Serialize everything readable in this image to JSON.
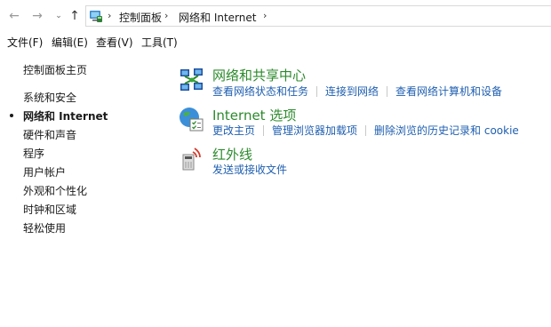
{
  "nav": {
    "back": "←",
    "forward": "→",
    "recent": "⌄",
    "up": "↑"
  },
  "breadcrumb": {
    "separator": "›",
    "items": [
      "控制面板",
      "网络和 Internet"
    ]
  },
  "menu": [
    "文件(F)",
    "编辑(E)",
    "查看(V)",
    "工具(T)"
  ],
  "sidebar": {
    "home": "控制面板主页",
    "items": [
      {
        "label": "系统和安全",
        "active": false
      },
      {
        "label": "网络和 Internet",
        "active": true
      },
      {
        "label": "硬件和声音",
        "active": false
      },
      {
        "label": "程序",
        "active": false
      },
      {
        "label": "用户帐户",
        "active": false
      },
      {
        "label": "外观和个性化",
        "active": false
      },
      {
        "label": "时钟和区域",
        "active": false
      },
      {
        "label": "轻松使用",
        "active": false
      }
    ]
  },
  "categories": [
    {
      "icon": "network-sharing-center-icon",
      "title": "网络和共享中心",
      "links": [
        "查看网络状态和任务",
        "连接到网络",
        "查看网络计算机和设备"
      ]
    },
    {
      "icon": "internet-options-icon",
      "title": "Internet 选项",
      "links": [
        "更改主页",
        "管理浏览器加载项",
        "删除浏览的历史记录和 cookie"
      ]
    },
    {
      "icon": "infrared-icon",
      "title": "红外线",
      "links": [
        "发送或接收文件"
      ]
    }
  ],
  "colors": {
    "title_green": "#2c8a2c",
    "link_blue": "#1f5fb0"
  }
}
